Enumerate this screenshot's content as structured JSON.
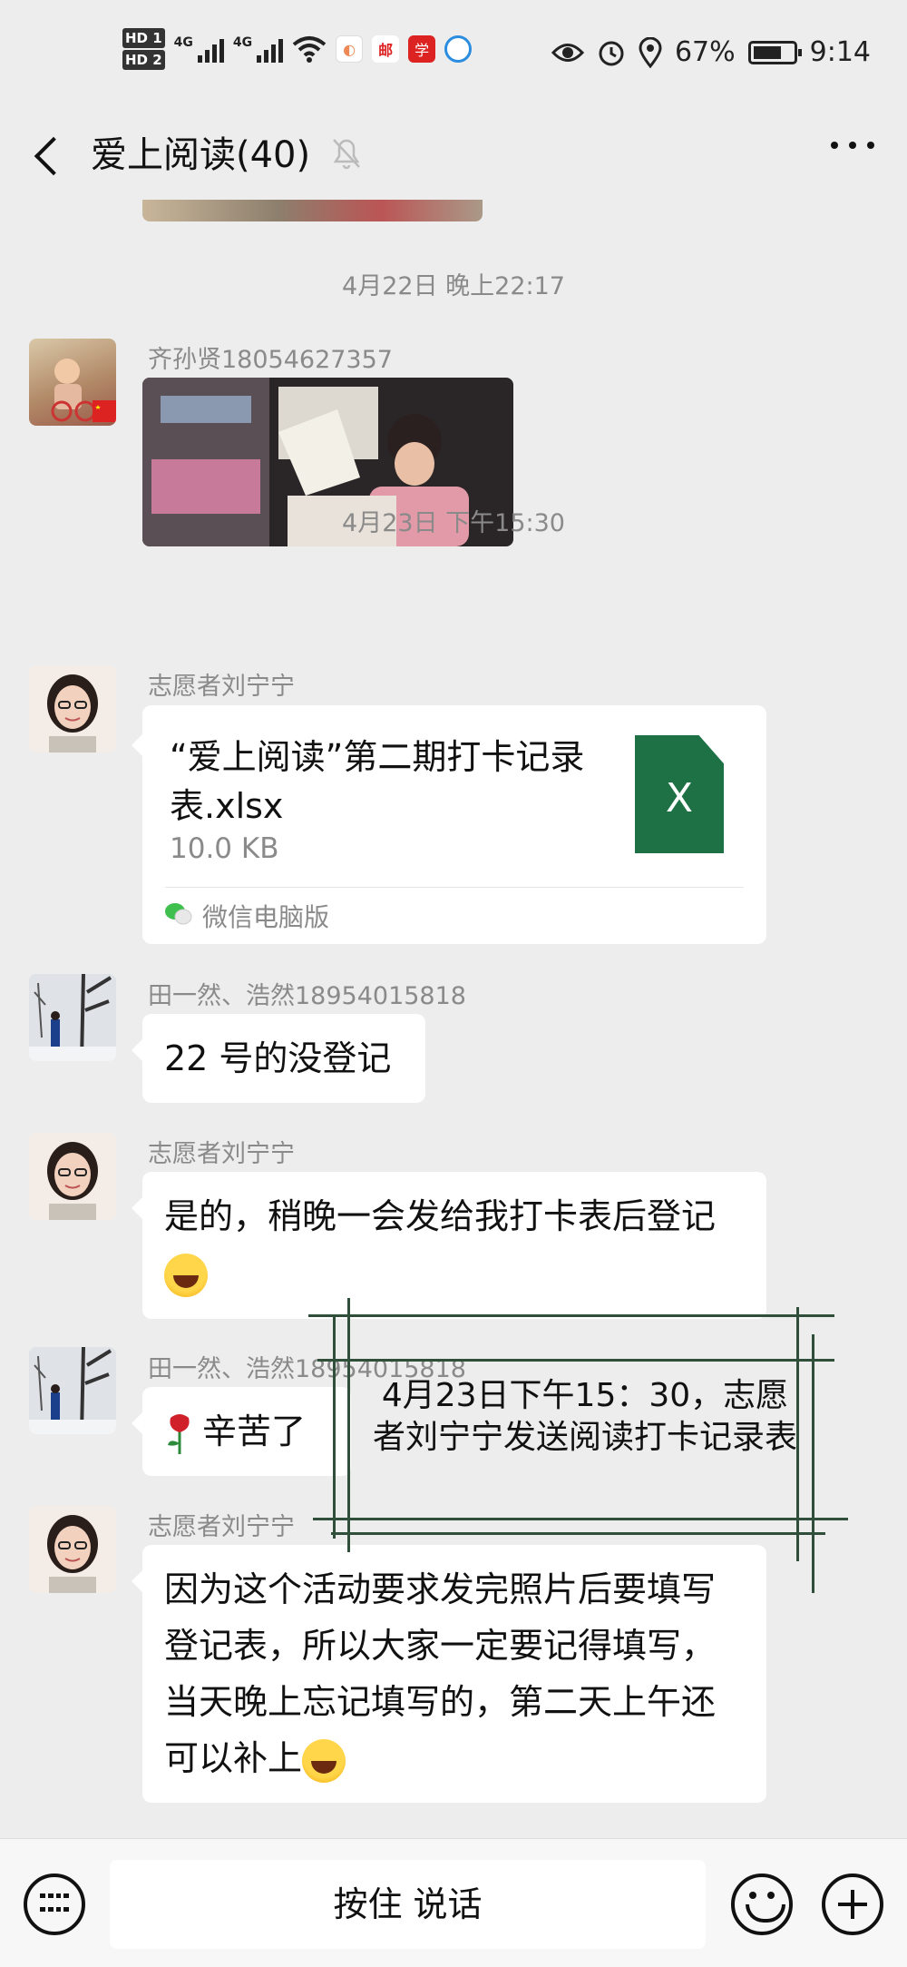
{
  "status_bar": {
    "hd_labels": [
      "HD 1",
      "HD 2"
    ],
    "network_1": "4G",
    "network_2": "4G",
    "battery": "67%",
    "time": "9:14"
  },
  "header": {
    "title": "爱上阅读(40)"
  },
  "messages": {
    "time_1": "4月22日 晚上22:17",
    "sender_1": "齐孙贤18054627357",
    "time_2": "4月23日 下午15:30",
    "sender_2": "志愿者刘宁宁",
    "file": {
      "name": "“爱上阅读”第二期打卡记录表.xlsx",
      "size": "10.0 KB",
      "icon_letter": "X",
      "source": "微信电脑版"
    },
    "sender_3": "田一然、浩然18954015818",
    "text_3": "22 号的没登记",
    "sender_4": "志愿者刘宁宁",
    "text_4": "是的，稍晚一会发给我打卡表后登记",
    "sender_5": "田一然、浩然18954015818",
    "text_5": "辛苦了",
    "sender_6": "志愿者刘宁宁",
    "text_6": "因为这个活动要求发完照片后要填写登记表，所以大家一定要记得填写，当天晚上忘记填写的，第二天上午还可以补上"
  },
  "annotation": {
    "text": "4月23日下午15：30，志愿者刘宁宁发送阅读打卡记录表"
  },
  "bottom_bar": {
    "voice_label": "按住 说话"
  },
  "colors": {
    "background": "#ededed",
    "bubble": "#ffffff",
    "excel_green": "#1e7145",
    "annotation_lines": "#2f4f3a"
  }
}
